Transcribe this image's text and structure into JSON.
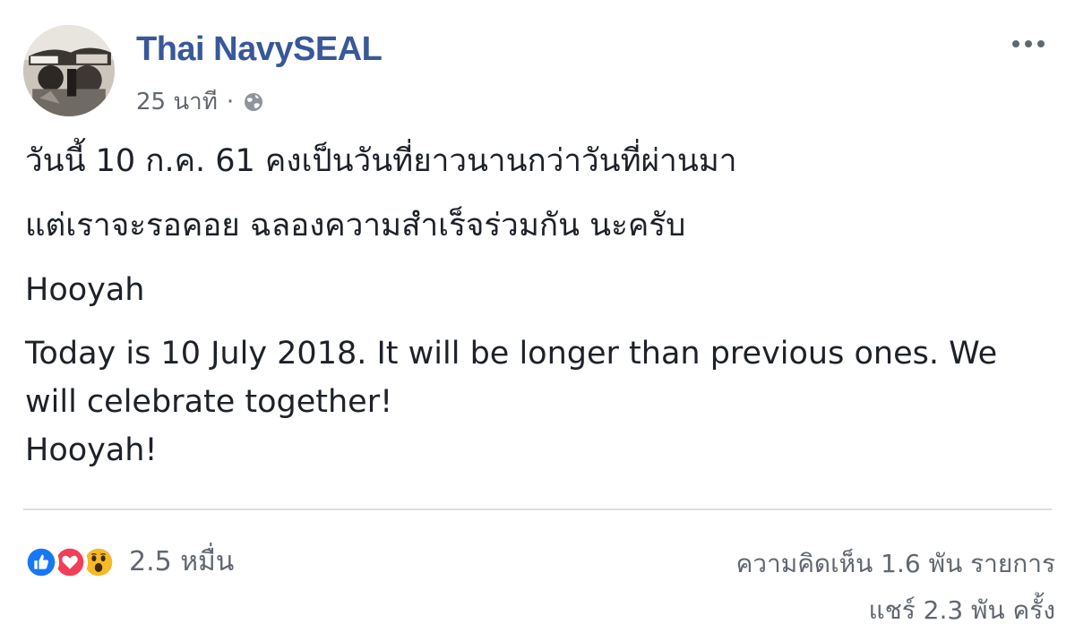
{
  "post": {
    "author": "Thai NavySEAL",
    "time": "25 นาที",
    "separator": "·",
    "lines_th": [
      "วันนี้ 10 ก.ค. 61 คงเป็นวันที่ยาวนานกว่าวันที่ผ่านมา",
      "แต่เราจะรอคอย ฉลองความสำเร็จร่วมกัน นะครับ",
      "Hooyah"
    ],
    "lines_en": [
      "Today is 10 July 2018. It will be longer than previous ones. We",
      "will celebrate together!",
      "Hooyah!"
    ]
  },
  "footer": {
    "reactions": [
      "like-icon",
      "love-icon",
      "wow-icon"
    ],
    "reaction_count": "2.5 หมื่น",
    "comments": "ความคิดเห็น 1.6 พัน รายการ",
    "shares": "แชร์ 2.3 พัน ครั้ง"
  },
  "colors": {
    "author": "#385898",
    "meta": "#606770",
    "like": "#1877f2",
    "love": "#f33e58",
    "wow": "#f7b928"
  }
}
